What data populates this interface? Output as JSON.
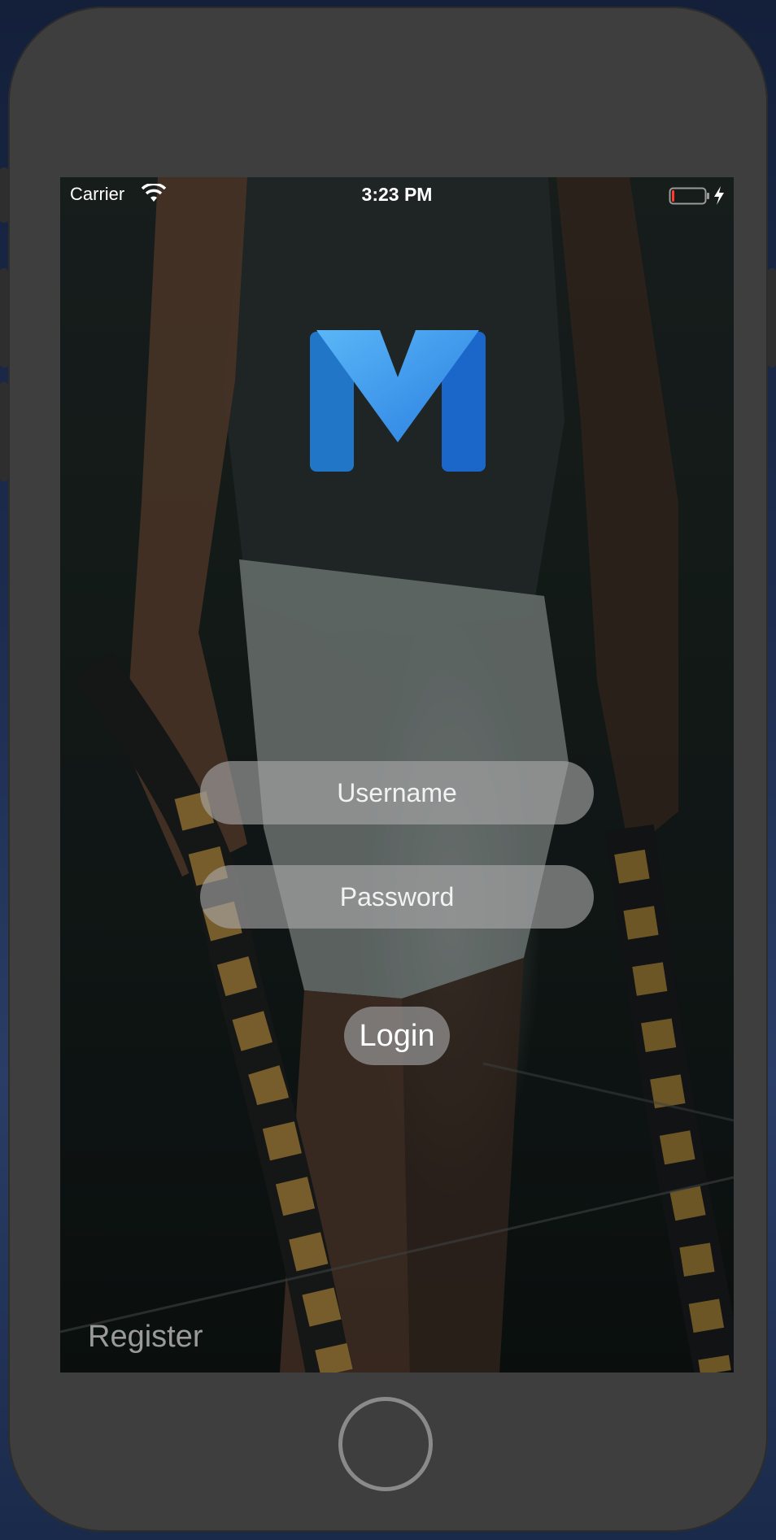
{
  "status_bar": {
    "carrier": "Carrier",
    "time": "3:23 PM",
    "wifi_icon": "wifi-icon",
    "battery_icon": "battery-low-icon",
    "charging_icon": "charging-bolt-icon"
  },
  "logo": {
    "icon": "m-logo-icon",
    "colors": [
      "#5ab0f5",
      "#2a7fe0",
      "#1a66c9"
    ]
  },
  "login_form": {
    "username_placeholder": "Username",
    "password_placeholder": "Password",
    "login_label": "Login"
  },
  "register_label": "Register",
  "device": {
    "home_button": "home-button"
  },
  "colors": {
    "field_bg": "#aaaaaa",
    "accent": "#2a7fe0",
    "battery_low": "#ff3b30"
  }
}
